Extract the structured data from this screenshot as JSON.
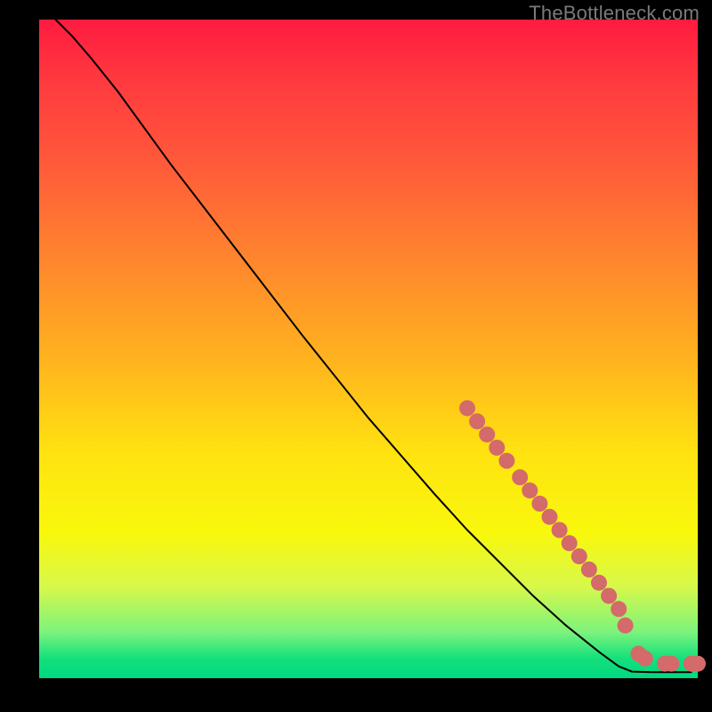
{
  "watermark": "TheBottleneck.com",
  "chart_data": {
    "type": "line",
    "title": "",
    "xlabel": "",
    "ylabel": "",
    "xlim": [
      0,
      100
    ],
    "ylim": [
      0,
      100
    ],
    "grid": false,
    "legend": false,
    "plot_background": "rainbow-vertical-gradient",
    "colors": {
      "line": "#000000",
      "marker_fill": "#d46a6a",
      "marker_stroke": "#c05555"
    },
    "curve": [
      {
        "x": 2.5,
        "y": 100.0
      },
      {
        "x": 5.0,
        "y": 97.5
      },
      {
        "x": 8.0,
        "y": 94.0
      },
      {
        "x": 12.0,
        "y": 89.0
      },
      {
        "x": 20.0,
        "y": 78.0
      },
      {
        "x": 30.0,
        "y": 65.0
      },
      {
        "x": 40.0,
        "y": 52.0
      },
      {
        "x": 50.0,
        "y": 39.5
      },
      {
        "x": 60.0,
        "y": 28.0
      },
      {
        "x": 65.0,
        "y": 22.5
      },
      {
        "x": 70.0,
        "y": 17.5
      },
      {
        "x": 75.0,
        "y": 12.5
      },
      {
        "x": 80.0,
        "y": 8.0
      },
      {
        "x": 85.0,
        "y": 4.0
      },
      {
        "x": 88.0,
        "y": 1.8
      },
      {
        "x": 90.0,
        "y": 1.0
      },
      {
        "x": 93.0,
        "y": 0.9
      },
      {
        "x": 96.0,
        "y": 0.9
      },
      {
        "x": 99.0,
        "y": 0.9
      }
    ],
    "markers": [
      {
        "x": 65.0,
        "y": 41.0
      },
      {
        "x": 66.5,
        "y": 39.0
      },
      {
        "x": 68.0,
        "y": 37.0
      },
      {
        "x": 69.5,
        "y": 35.0
      },
      {
        "x": 71.0,
        "y": 33.0
      },
      {
        "x": 73.0,
        "y": 30.5
      },
      {
        "x": 74.5,
        "y": 28.5
      },
      {
        "x": 76.0,
        "y": 26.5
      },
      {
        "x": 77.5,
        "y": 24.5
      },
      {
        "x": 79.0,
        "y": 22.5
      },
      {
        "x": 80.5,
        "y": 20.5
      },
      {
        "x": 82.0,
        "y": 18.5
      },
      {
        "x": 83.5,
        "y": 16.5
      },
      {
        "x": 85.0,
        "y": 14.5
      },
      {
        "x": 86.5,
        "y": 12.5
      },
      {
        "x": 88.0,
        "y": 10.5
      },
      {
        "x": 89.0,
        "y": 8.0
      },
      {
        "x": 91.0,
        "y": 3.7
      },
      {
        "x": 92.0,
        "y": 3.0
      },
      {
        "x": 95.0,
        "y": 2.2
      },
      {
        "x": 96.0,
        "y": 2.2
      },
      {
        "x": 99.0,
        "y": 2.2
      },
      {
        "x": 100.0,
        "y": 2.2
      }
    ]
  }
}
